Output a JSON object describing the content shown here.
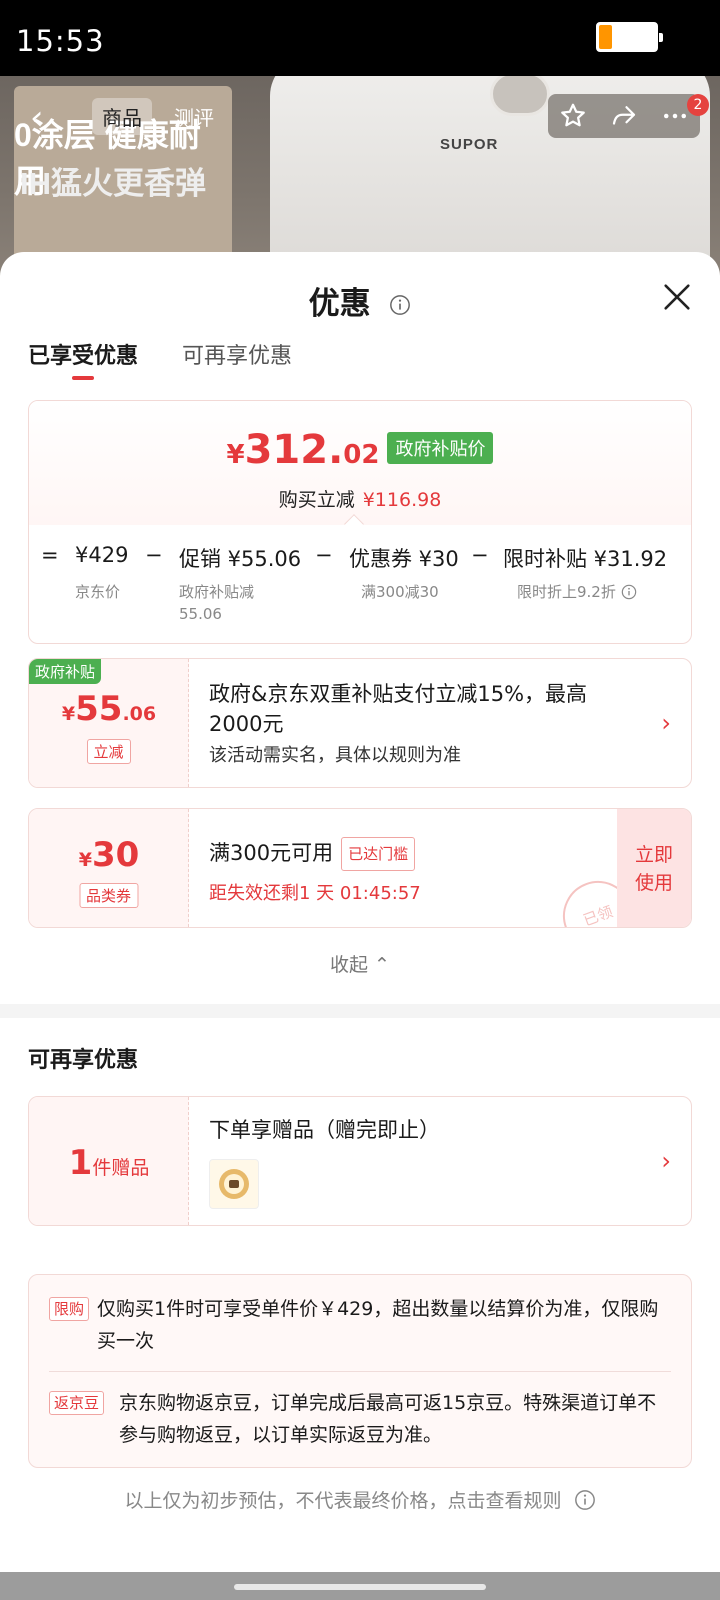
{
  "status_bar": {
    "time": "15:53"
  },
  "product_header": {
    "promo_line1": "0涂层 健康耐用",
    "promo_line2": "IH猛火更香弹",
    "brand": "SUPOR",
    "tabs": [
      "商品",
      "测评"
    ],
    "cart_badge": "2"
  },
  "sheet": {
    "title": "优惠",
    "tabs": [
      {
        "label": "已享受优惠",
        "active": true
      },
      {
        "label": "可再享优惠",
        "active": false
      }
    ]
  },
  "breakdown": {
    "price_currency": "¥",
    "price_int": "312.",
    "price_dec": "02",
    "price_tag": "政府补贴价",
    "reduce_label": "购买立减",
    "reduce_amount": "¥116.98",
    "equals": "=",
    "minus": "−",
    "items": [
      {
        "value": "¥429",
        "label": "京东价"
      },
      {
        "value": "促销 ¥55.06",
        "label": "政府补贴减",
        "label2": "55.06"
      },
      {
        "value": "优惠券 ¥30",
        "label": "满300减30"
      },
      {
        "value": "限时补贴 ¥31.92",
        "label": "限时折上9.2折"
      }
    ]
  },
  "gov_subsidy": {
    "tag": "政府补贴",
    "currency": "¥",
    "amount_int": "55",
    "amount_dec": ".06",
    "badge": "立减",
    "title": "政府&京东双重补贴支付立减15%，最高2000元",
    "desc": "该活动需实名，具体以规则为准",
    "chevron": "›"
  },
  "coupon": {
    "currency": "¥",
    "amount": "30",
    "badge": "品类券",
    "title": "满300元可用",
    "reached": "已达门槛",
    "countdown": "距失效还剩1 天 01:45:57",
    "use_label_1": "立即",
    "use_label_2": "使用",
    "stamp": "已领"
  },
  "collapse_label": "收起 ⌃",
  "more_section": {
    "title": "可再享优惠",
    "gift_count": "1",
    "gift_unit": "件赠品",
    "gift_title": "下单享赠品（赠完即止）",
    "chevron": "›"
  },
  "rules": [
    {
      "tag": "限购",
      "text": "仅购买1件时可享受单件价￥429，超出数量以结算价为准，仅限购买一次"
    },
    {
      "tag": "返京豆",
      "text": "京东购物返京豆，订单完成后最高可返15京豆。特殊渠道订单不参与购物返豆，以订单实际返豆为准。"
    }
  ],
  "footer_note": "以上仅为初步预估，不代表最终价格，点击查看规则",
  "colors": {
    "accent": "#e4393c",
    "gov_green": "#4caf50"
  }
}
